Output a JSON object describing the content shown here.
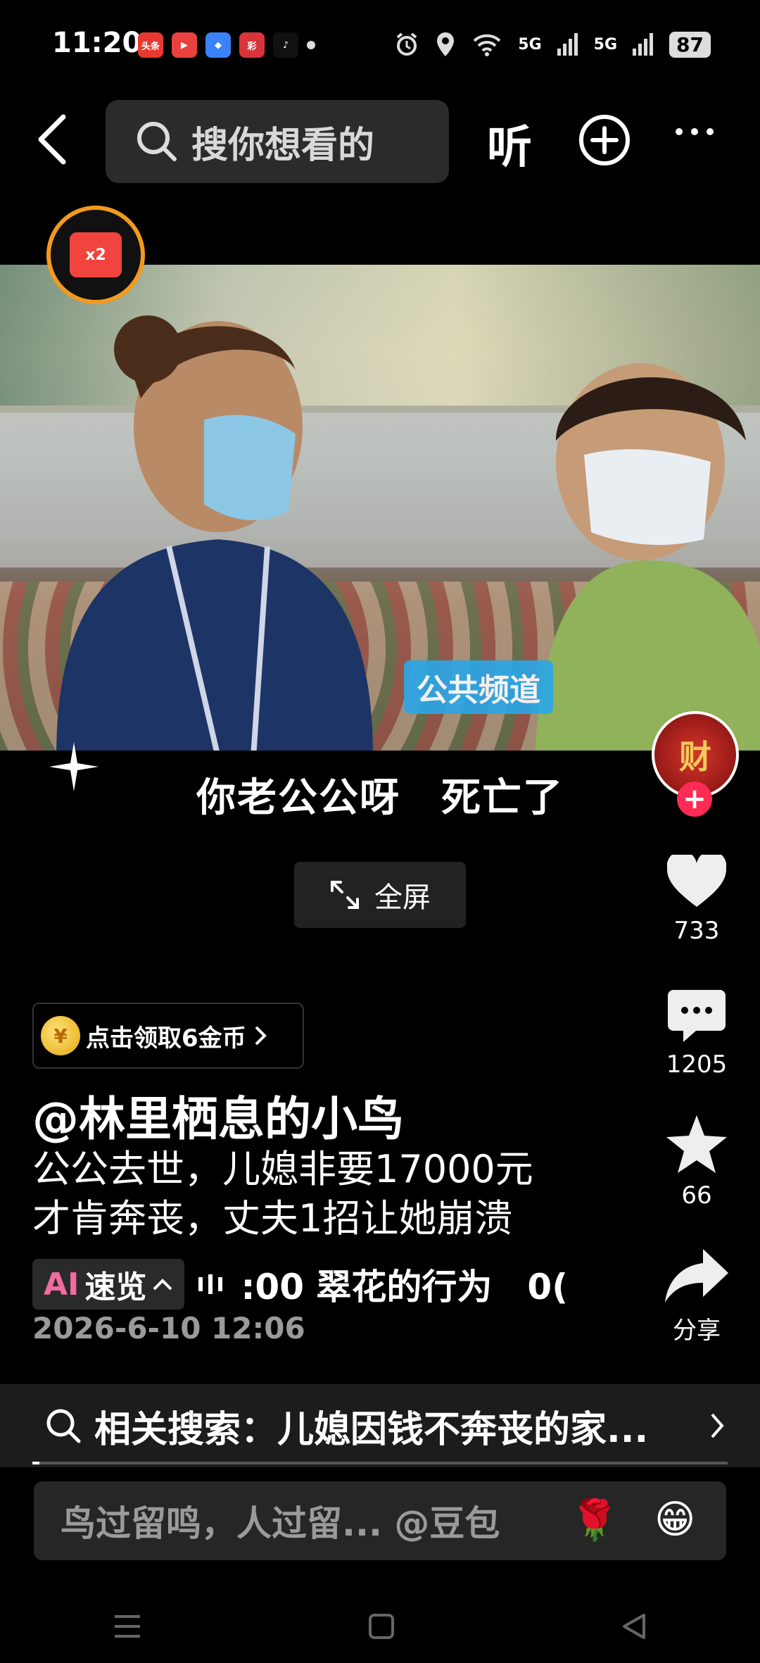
{
  "status_bar": {
    "time": "11:20",
    "app_icons": [
      "头条",
      "▶",
      "◆",
      "彩",
      "♪"
    ],
    "battery": "87",
    "signal_1": "5G",
    "signal_2": "5G"
  },
  "top_bar": {
    "search_placeholder": "搜你想看的",
    "listen_label": "听"
  },
  "redpacket": {
    "multiplier": "x2"
  },
  "video": {
    "channel_logo": "公共频道",
    "subtitle": "你老公公呀　死亡了"
  },
  "fullscreen_label": "全屏",
  "avatar_text": "财",
  "rail": {
    "likes": "733",
    "comments": "1205",
    "favorites": "66",
    "share_label": "分享"
  },
  "coin_promo": "点击领取6金币",
  "coin_symbol": "¥",
  "author": "@林里栖息的小鸟",
  "description_line1": "公公去世，儿媳非要17000元",
  "description_line2": "才肯奔丧，丈夫1招让她崩溃",
  "ai_summary": {
    "ai_label": "AI",
    "label": "速览",
    "marquee": ":00 翠花的行为　0("
  },
  "date": "2026-6-10 12:06",
  "related_search": "相关搜索：儿媳因钱不奔丧的家...",
  "comment_placeholder": "鸟过留鸣，人过留... @豆包",
  "emojis": [
    "🌹",
    "😁"
  ],
  "colors": {
    "accent_red": "#fe2c55",
    "redpacket_ring": "#f39a1e"
  }
}
